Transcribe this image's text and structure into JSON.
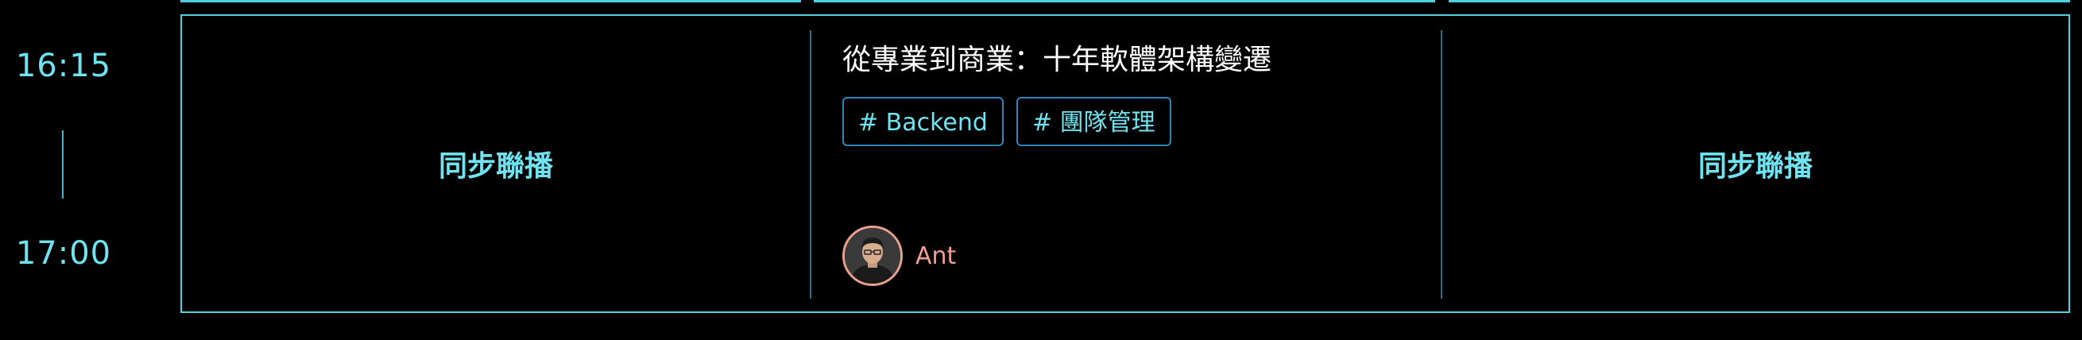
{
  "colors": {
    "accent": "#4fd2e0",
    "time_text": "#6fe3f0",
    "divider": "#2a6f8a",
    "tag_border": "#2e86b8",
    "speaker_name": "#f0a090",
    "background": "#000000"
  },
  "timeslot": {
    "start": "16:15",
    "end": "17:00"
  },
  "columns": [
    {
      "type": "simulcast",
      "label": "同步聯播"
    },
    {
      "type": "session",
      "title": "從專業到商業：十年軟體架構變遷",
      "tags": [
        "# Backend",
        "# 團隊管理"
      ],
      "speaker": {
        "name": "Ant",
        "avatar_icon": "speaker-avatar-photo"
      }
    },
    {
      "type": "simulcast",
      "label": "同步聯播"
    }
  ]
}
